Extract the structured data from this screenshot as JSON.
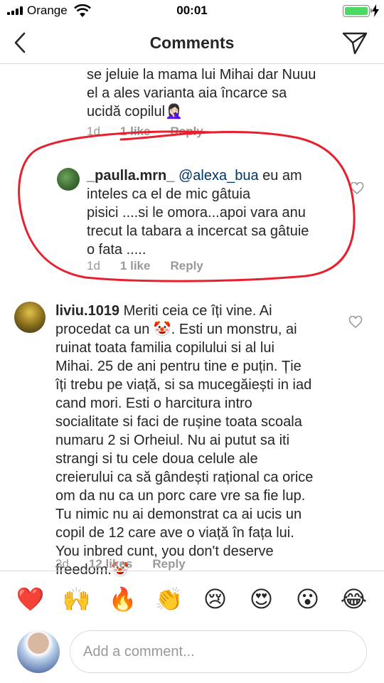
{
  "status_bar": {
    "carrier": "Orange",
    "time": "00:01",
    "battery_level": 1.0,
    "signal_bars": 4
  },
  "header": {
    "title": "Comments",
    "back_icon": "chevron-left-icon",
    "send_icon": "paper-plane-icon"
  },
  "comments": [
    {
      "text": "se jeluie la mama lui Mihai dar Nuuu\nel a ales varianta aia încarce sa\nucidă copilul🤦🏻‍♀️",
      "age": "1d",
      "likes": "1 like",
      "reply": "Reply"
    },
    {
      "username": "_paulla.mrn_",
      "mention": "@alexa_bua",
      "text": " eu am\ninteles ca el de mic gâtuia\npisici ....si le omora...apoi vara anu\ntrecut la tabara a incercat sa gâtuie\no fata .....",
      "age": "1d",
      "likes": "1 like",
      "reply": "Reply"
    },
    {
      "username": "liviu.1019",
      "text": " Meriti ceia ce îți vine. Ai\nprocedat ca un 🤡. Esti un monstru, ai\nruinat toata familia copilului si al lui\nMihai. 25 de ani pentru tine e puțin. Ție\nîți trebu pe viață, si sa mucegăiești in iad\ncand mori. Esti o harcitura intro\nsocialitate si faci de rușine toata scoala\nnumaru 2 si Orheiul. Nu ai putut sa iti\nstrangi si tu cele doua celule ale\ncreierului ca să gândești rațional ca orice\nom da nu ca un porc care vre sa fie lup.\nTu nimic nu ai demonstrat ca ai ucis un\ncopil de 12 care ave o viață în fața lui.\nYou inbred cunt, you don't deserve\nfreedom.🤡",
      "age": "3d",
      "likes": "12 likes",
      "reply": "Reply"
    }
  ],
  "emoji_bar": [
    "❤️",
    "🙌",
    "🔥",
    "👏",
    "😢",
    "😍",
    "😮",
    "😂"
  ],
  "composer": {
    "placeholder": "Add a comment..."
  },
  "colors": {
    "annotation": "#e8202e",
    "mention": "#003569",
    "meta": "#999999",
    "battery": "#4cd964"
  }
}
